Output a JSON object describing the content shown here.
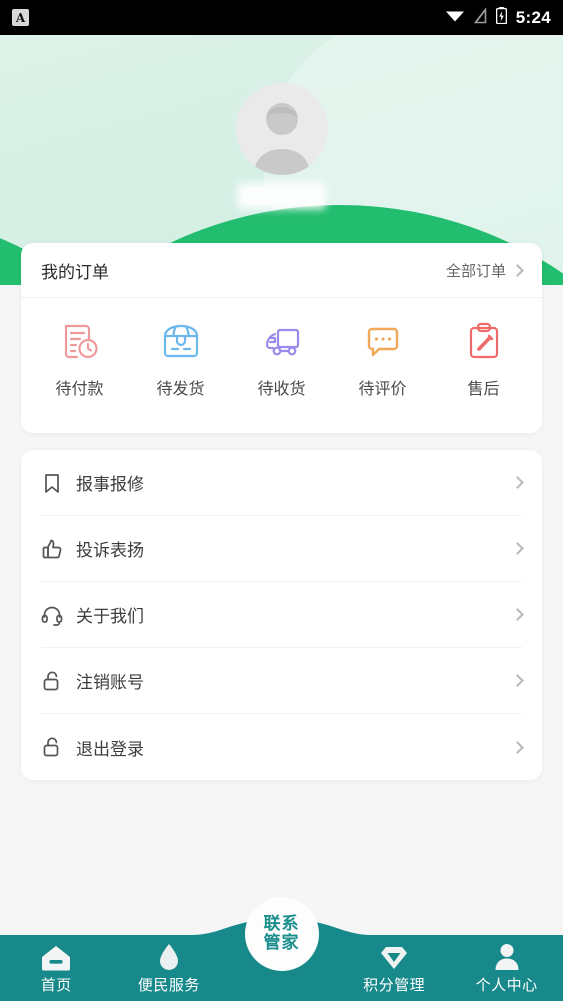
{
  "statusbar": {
    "app_icon": "A",
    "time": "5:24",
    "icons": [
      "wifi-icon",
      "signal-off-icon",
      "battery-charging-icon"
    ]
  },
  "header": {
    "avatar": "default-user-avatar",
    "username": ""
  },
  "order": {
    "title": "我的订单",
    "all_label": "全部订单",
    "items": [
      {
        "label": "待付款",
        "icon": "invoice-clock-icon",
        "color": "#ef9a9a"
      },
      {
        "label": "待发货",
        "icon": "package-box-icon",
        "color": "#6bb8ec"
      },
      {
        "label": "待收货",
        "icon": "delivery-truck-icon",
        "color": "#9b8ae8"
      },
      {
        "label": "待评价",
        "icon": "comment-bubble-icon",
        "color": "#f0a85a"
      },
      {
        "label": "售后",
        "icon": "clipboard-pencil-icon",
        "color": "#ef6b6b"
      }
    ]
  },
  "menu": {
    "items": [
      {
        "label": "报事报修",
        "icon": "bookmark-icon"
      },
      {
        "label": "投诉表扬",
        "icon": "thumbs-up-icon"
      },
      {
        "label": "关于我们",
        "icon": "headset-icon"
      },
      {
        "label": "注销账号",
        "icon": "unlock-icon"
      },
      {
        "label": "退出登录",
        "icon": "unlock-icon"
      }
    ]
  },
  "navbar": {
    "background_color": "#18898a",
    "items": [
      {
        "label": "首页",
        "icon": "home-icon"
      },
      {
        "label": "便民服务",
        "icon": "water-drop-icon"
      },
      {
        "label": "积分管理",
        "icon": "diamond-icon"
      },
      {
        "label": "个人中心",
        "icon": "person-icon"
      }
    ],
    "fab": {
      "line1": "联系",
      "line2": "管家",
      "icon": "contact-butler-button"
    }
  }
}
